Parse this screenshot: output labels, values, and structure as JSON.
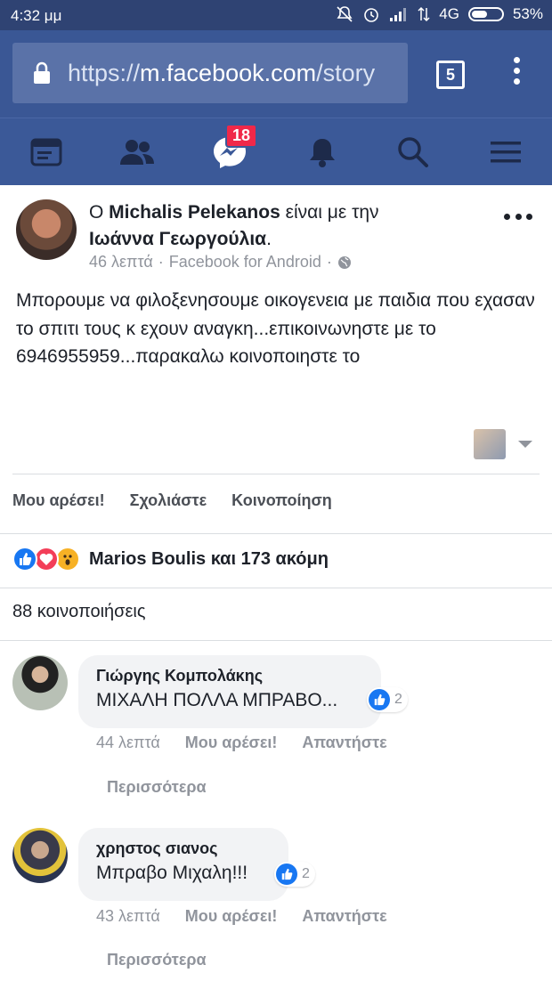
{
  "status_bar": {
    "time": "4:32 μμ",
    "network": "4G",
    "battery_percent": "53%",
    "battery_level": 0.53
  },
  "browser": {
    "url_scheme": "https://",
    "url_host": "m.facebook.com",
    "url_path": "/story",
    "tab_count": "5"
  },
  "nav": {
    "items": [
      "news-feed",
      "friends",
      "messenger",
      "notifications",
      "search",
      "menu"
    ],
    "messenger_badge": "18"
  },
  "post": {
    "prefix": "Ο ",
    "author": "Michalis Pelekanos",
    "with_text": " είναι με την ",
    "tagged": "Ιωάννα Γεωργούλια",
    "tagged_suffix": ".",
    "time": "46 λεπτά",
    "source": "Facebook for Android",
    "privacy_icon": "globe-icon",
    "body": "Μπορουμε να φιλοξενησουμε οικογενεια με παιδια που εχασαν το σπιτι τους κ εχουν αναγκη...επικοινωνηστε με το 6946955959...παρακαλω κοινοποιηστε το"
  },
  "actions": {
    "like": "Μου αρέσει!",
    "comment": "Σχολιάστε",
    "share": "Κοινοποίηση"
  },
  "reactions": {
    "icons": [
      "like",
      "love",
      "wow"
    ],
    "summary": "Marios Boulis και 173 ακόμη"
  },
  "shares": "88 κοινοποιήσεις",
  "comments": [
    {
      "name": "Γιώργης Κομπολάκης",
      "text": "ΜΙΧΑΛΗ ΠΟΛΛΑ ΜΠΡΑΒΟ...",
      "likes": "2",
      "time": "44 λεπτά",
      "like_label": "Μου αρέσει!",
      "reply_label": "Απαντήστε",
      "more_label": "Περισσότερα"
    },
    {
      "name": "χρηστος σιανος",
      "text": "Μπραβο Μιχαλη!!!",
      "likes": "2",
      "time": "43 λεπτά",
      "like_label": "Μου αρέσει!",
      "reply_label": "Απαντήστε",
      "more_label": "Περισσότερα"
    }
  ],
  "colors": {
    "status_bar": "#2f4373",
    "url_bar": "#3a5795",
    "fb_nav": "#3b5998",
    "badge": "#f02849",
    "like_blue": "#1877f2"
  }
}
